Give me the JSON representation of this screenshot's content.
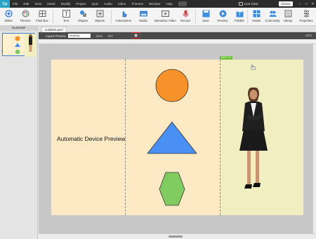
{
  "app": {
    "logo": "Cp"
  },
  "menu": [
    "File",
    "Edit",
    "View",
    "Insert",
    "Modify",
    "Project",
    "Quiz",
    "Audio",
    "Video",
    "Themes",
    "Window",
    "Help"
  ],
  "menubar_right": {
    "live_chat": "Live Chat",
    "workspace": "Classic"
  },
  "toolbar": {
    "slides": "Slides",
    "themes": "Themes",
    "fluid_box": "Fluid Box",
    "text": "Text",
    "shapes": "Shapes",
    "objects": "Objects",
    "interactions": "Interactions",
    "media": "Media",
    "interactive_video": "Interactive Video",
    "record": "Record",
    "save": "Save",
    "preview": "Preview",
    "publish": "Publish",
    "assets": "Assets",
    "community": "Community",
    "library": "Library",
    "properties": "Properties"
  },
  "filmstrip": {
    "header": "FILMSTRIP",
    "slide_number": "1"
  },
  "document": {
    "tab": "untitled5.cptx*"
  },
  "preview_bar": {
    "label": "Layout Preview",
    "selected": "Desktop",
    "breakpoints": [
      "1024",
      "627"
    ],
    "right": "1024"
  },
  "stage": {
    "title": "Automatic Device Preview",
    "breakpoint_tag": "627x7.71"
  },
  "colors": {
    "stage_left": "#fde9c3",
    "stage_right": "#f1efc2",
    "circle": "#f7922a",
    "triangle": "#4a90f4",
    "hexagon": "#80cc61",
    "highlight": "#e02020"
  }
}
